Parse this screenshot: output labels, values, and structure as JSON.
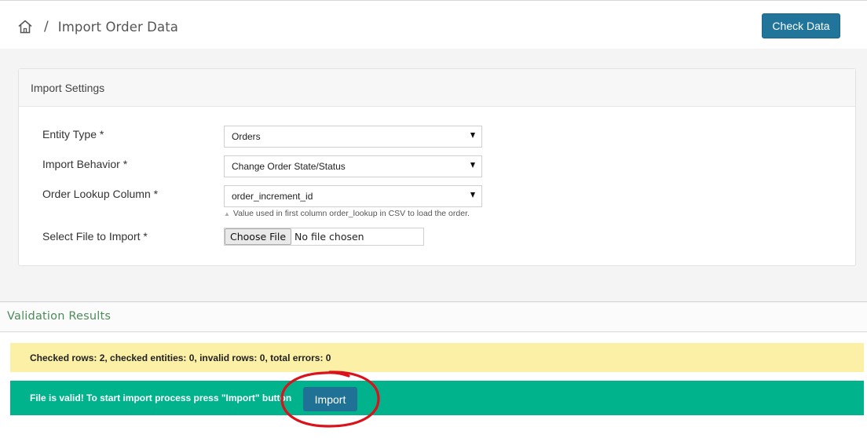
{
  "header": {
    "separator": "/",
    "title": "Import Order Data",
    "check_button": "Check Data",
    "home_icon": "home-icon"
  },
  "settings": {
    "title": "Import Settings",
    "entity_type": {
      "label": "Entity Type *",
      "value": "Orders"
    },
    "import_behavior": {
      "label": "Import Behavior *",
      "value": "Change Order State/Status"
    },
    "lookup_column": {
      "label": "Order Lookup Column *",
      "value": "order_increment_id",
      "hint": "Value used in first column order_lookup in CSV to load the order."
    },
    "file": {
      "label": "Select File to Import *",
      "button": "Choose File",
      "status": "No file chosen"
    }
  },
  "validation": {
    "title": "Validation Results",
    "summary": "Checked rows: 2, checked entities: 0, invalid rows: 0, total errors: 0",
    "success": "File is valid! To start import process press \"Import\" button",
    "import_button": "Import"
  },
  "colors": {
    "primary": "#21759b",
    "success": "#00b38c",
    "warning": "#fcf0a6",
    "annotation": "#d9121b",
    "section_title": "#4a8c5a"
  }
}
